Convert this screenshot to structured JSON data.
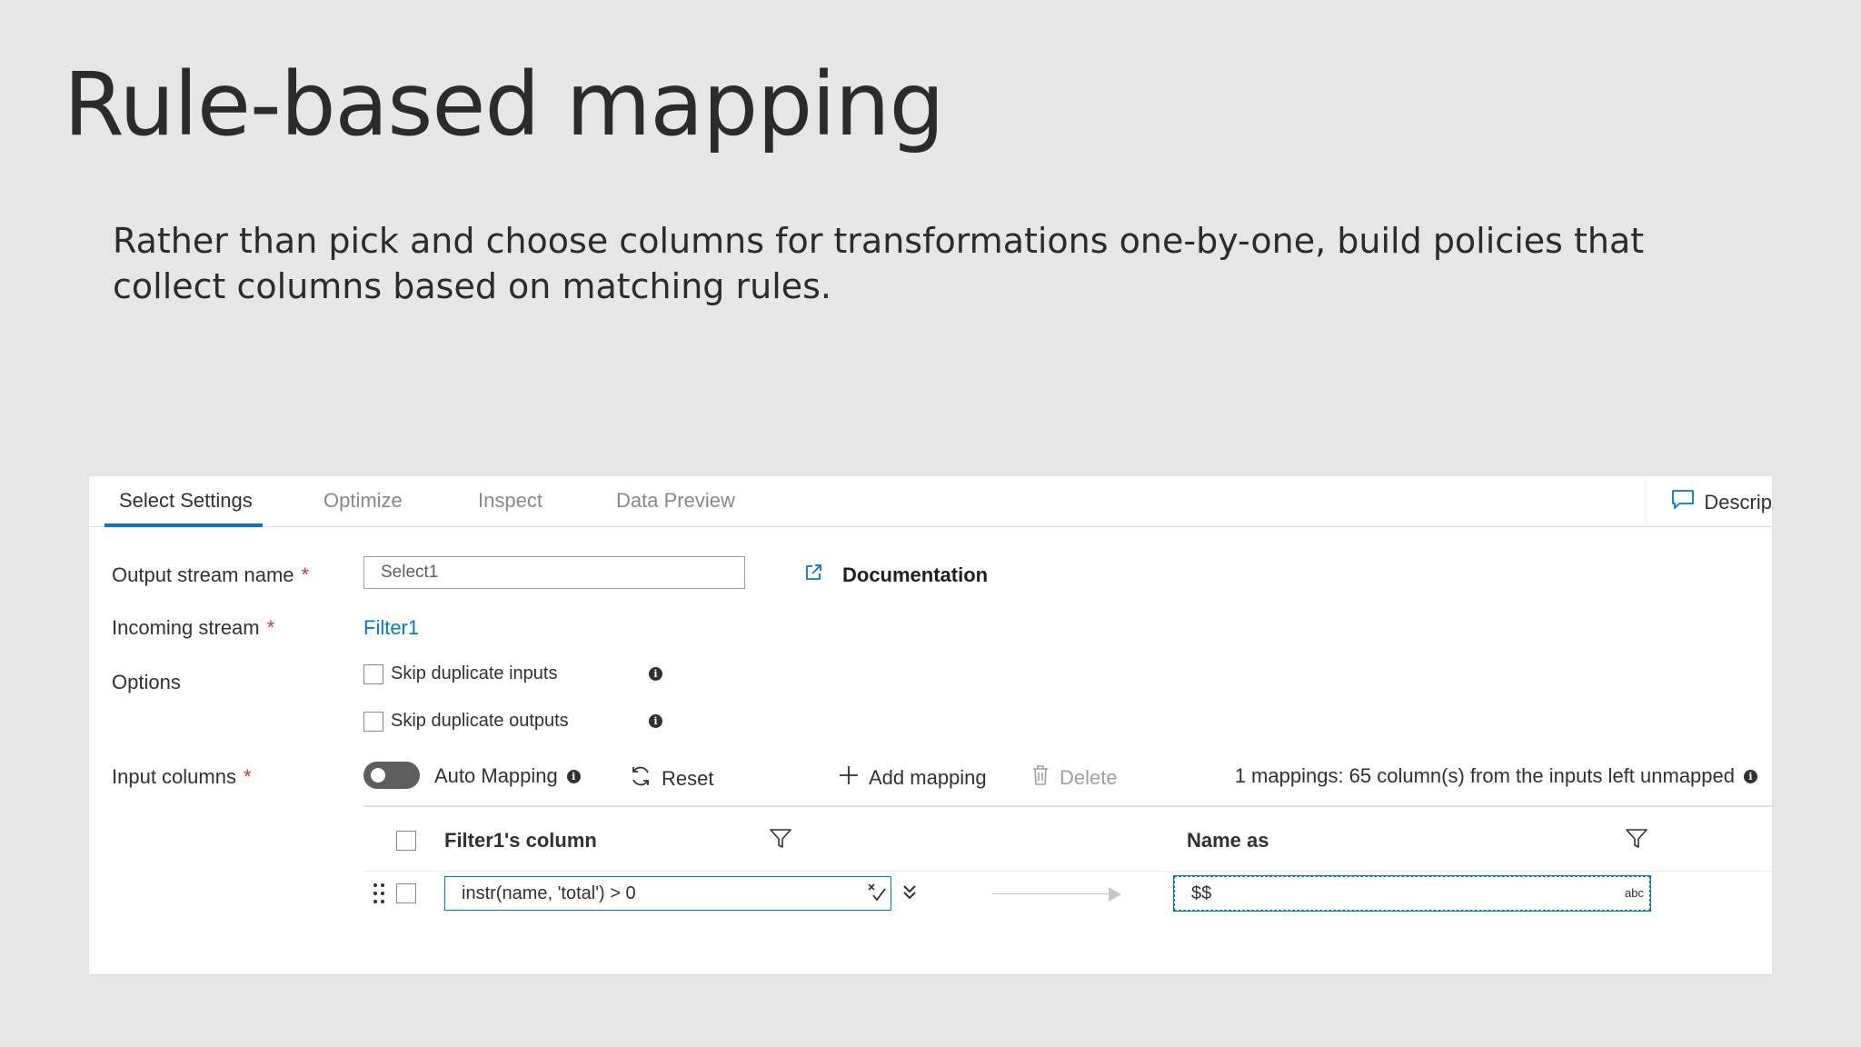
{
  "slide": {
    "title": "Rule-based mapping",
    "body": "Rather than pick and choose columns for transformations one-by-one, build policies that collect columns based on matching rules."
  },
  "tabs": [
    {
      "label": "Select Settings",
      "active": true
    },
    {
      "label": "Optimize",
      "active": false
    },
    {
      "label": "Inspect",
      "active": false
    },
    {
      "label": "Data Preview",
      "active": false
    }
  ],
  "description_button": {
    "label": "Descrip",
    "icon": "comment-icon"
  },
  "form": {
    "output_stream": {
      "label": "Output stream name",
      "required_mark": "*",
      "value": "Select1"
    },
    "documentation_link": {
      "label": "Documentation",
      "icon": "external-link-icon"
    },
    "incoming_stream": {
      "label": "Incoming stream",
      "required_mark": "*",
      "value": "Filter1"
    },
    "options": {
      "label": "Options",
      "items": [
        {
          "label": "Skip duplicate inputs",
          "checked": false
        },
        {
          "label": "Skip duplicate outputs",
          "checked": false
        }
      ]
    },
    "input_columns": {
      "label": "Input columns",
      "required_mark": "*"
    }
  },
  "toolbar": {
    "auto_mapping": {
      "label": "Auto Mapping",
      "enabled": false
    },
    "reset": {
      "label": "Reset",
      "icon": "refresh-icon"
    },
    "add_mapping": {
      "label": "Add mapping",
      "icon": "plus-icon"
    },
    "delete": {
      "label": "Delete",
      "icon": "trash-icon",
      "disabled": true
    },
    "status": "1 mappings: 65 column(s) from the inputs left unmapped"
  },
  "grid": {
    "headers": {
      "source": "Filter1's column",
      "target": "Name as"
    },
    "rows": [
      {
        "source_expression": "instr(name, 'total') > 0",
        "target_name": "$$",
        "target_type": "abc"
      }
    ]
  },
  "colors": {
    "accent": "#0078d4",
    "required": "#d13438",
    "background": "#e6e6e7"
  }
}
